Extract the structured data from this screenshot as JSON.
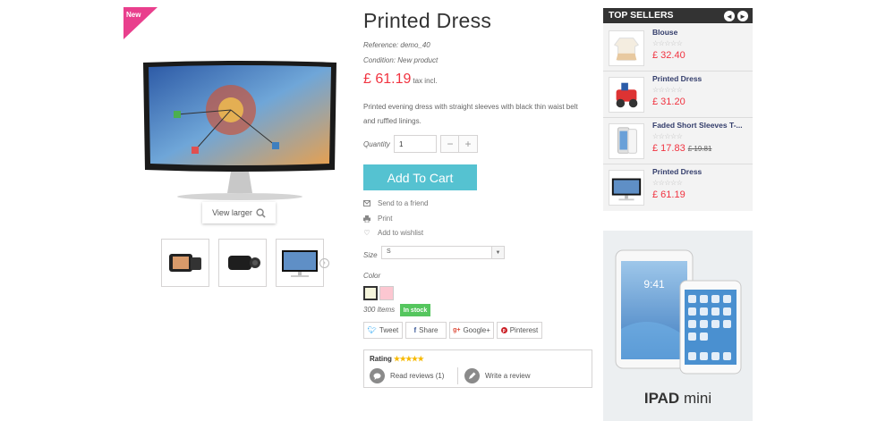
{
  "product": {
    "new_badge": "New",
    "title": "Printed Dress",
    "reference_label": "Reference:",
    "reference_value": "demo_40",
    "condition_label": "Condition:",
    "condition_value": "New product",
    "price": "£ 61.19",
    "tax_note": "tax incl.",
    "description": "Printed evening dress with straight sleeves with black thin waist belt and ruffled linings.",
    "quantity_label": "Quantity",
    "quantity_value": "1",
    "minus_label": "−",
    "plus_label": "+",
    "add_to_cart": "Add To Cart",
    "send_to_friend": "Send to a friend",
    "print": "Print",
    "add_to_wishlist": "Add to wishlist",
    "size_label": "Size",
    "size_value": "S",
    "color_label": "Color",
    "colors": [
      "#f5f5dc",
      "#fcc7d1"
    ],
    "stock_count": "300 Items",
    "stock_status": "In stock",
    "view_larger": "View larger"
  },
  "social": {
    "tweet": "Tweet",
    "share": "Share",
    "google": "Google+",
    "pinterest": "Pinterest"
  },
  "rating": {
    "label": "Rating",
    "read_reviews": "Read reviews (1)",
    "write_review": "Write a review"
  },
  "top_sellers": {
    "title": "TOP SELLERS",
    "items": [
      {
        "name": "Blouse",
        "price": "£ 32.40",
        "old_price": ""
      },
      {
        "name": "Printed Dress",
        "price": "£ 31.20",
        "old_price": ""
      },
      {
        "name": "Faded Short Sleeves T-...",
        "price": "£ 17.83",
        "old_price": "£ 19.81"
      },
      {
        "name": "Printed Dress",
        "price": "£ 61.19",
        "old_price": ""
      }
    ]
  },
  "ad": {
    "brand": "IPAD",
    "model": "mini",
    "screen_time": "9:41"
  },
  "colors": {
    "accent_price": "#f13340",
    "cart_button": "#55c2d1",
    "in_stock": "#55c65e",
    "new_badge": "#e93f8d",
    "header_dark": "#333333"
  }
}
